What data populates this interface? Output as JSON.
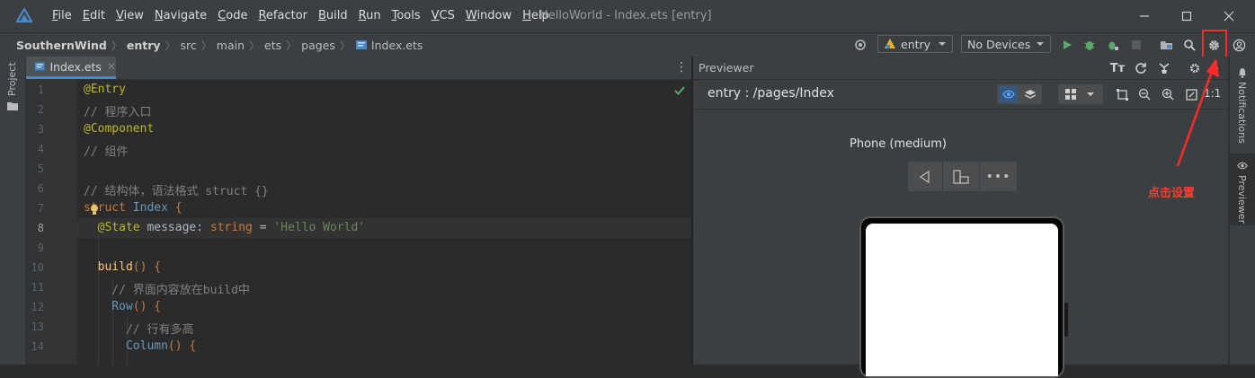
{
  "menu": {
    "items": [
      {
        "label": "File",
        "mnemonic": "F",
        "rest": "ile"
      },
      {
        "label": "Edit",
        "mnemonic": "E",
        "rest": "dit"
      },
      {
        "label": "View",
        "mnemonic": "V",
        "rest": "iew"
      },
      {
        "label": "Navigate",
        "mnemonic": "N",
        "rest": "avigate"
      },
      {
        "label": "Code",
        "mnemonic": "C",
        "rest": "ode"
      },
      {
        "label": "Refactor",
        "mnemonic": "R",
        "rest": "efactor"
      },
      {
        "label": "Build",
        "mnemonic": "B",
        "rest": "uild"
      },
      {
        "label": "Run",
        "mnemonic": "R",
        "rest": "un"
      },
      {
        "label": "Tools",
        "mnemonic": "T",
        "rest": "ools"
      },
      {
        "label": "VCS",
        "mnemonic": "V",
        "rest": "CS"
      },
      {
        "label": "Window",
        "mnemonic": "W",
        "rest": "indow"
      },
      {
        "label": "Help",
        "mnemonic": "H",
        "rest": "elp"
      }
    ]
  },
  "window": {
    "title": "HelloWorld - Index.ets [entry]"
  },
  "breadcrumb": [
    "SouthernWind",
    "entry",
    "src",
    "main",
    "ets",
    "pages",
    "Index.ets"
  ],
  "toolbar": {
    "run_config": "entry",
    "devices": "No Devices"
  },
  "sidebar": {
    "project_label": "Project"
  },
  "editor": {
    "tab_label": "Index.ets",
    "line_numbers": [
      "1",
      "2",
      "3",
      "4",
      "5",
      "6",
      "7",
      "8",
      "9",
      "10",
      "11",
      "12",
      "13",
      "14"
    ],
    "lines": {
      "l1": "@Entry",
      "l2": "// 程序入口",
      "l3": "@Component",
      "l4": "// 组件",
      "l6": "// 结构体，语法格式 struct {}",
      "l7a": "struct",
      "l7b": "Index",
      "l7c": " {",
      "l8a": "  @State",
      "l8b": " message",
      "l8c": ": ",
      "l8d": "string",
      "l8e": " = ",
      "l8f": "'Hello World'",
      "l10a": "  build",
      "l10b": "() {",
      "l11": "    // 界面内容放在build中",
      "l12a": "    Row",
      "l12b": "() {",
      "l13": "      // 行有多高",
      "l14a": "      Column",
      "l14b": "() {"
    }
  },
  "previewer": {
    "title": "Previewer",
    "route": "entry : /pages/Index",
    "device_name": "Phone (medium)",
    "zoom_label": "1:1"
  },
  "rightbar": {
    "notifications": "Notifications",
    "previewer": "Previewer"
  },
  "annotation": {
    "text": "点击设置",
    "color": "#ff3b30"
  },
  "colors": {
    "accent": "#4a88c7",
    "run_green": "#59a869",
    "window_bg": "#3c3f41",
    "editor_bg": "#2b2b2b"
  }
}
